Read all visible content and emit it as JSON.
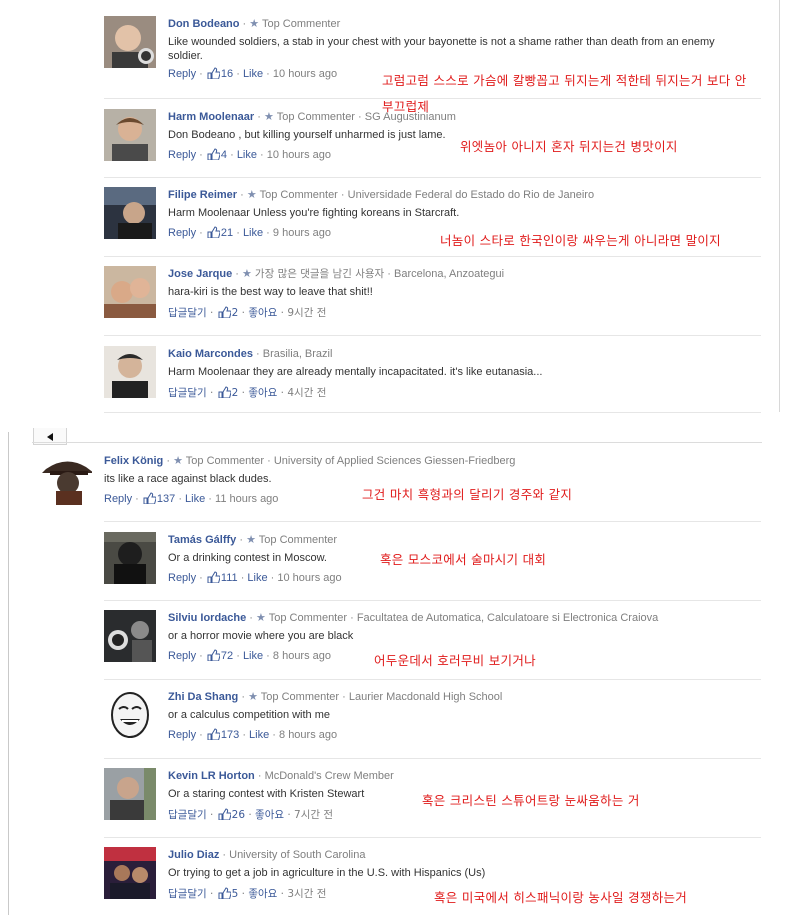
{
  "labels": {
    "top_commenter": "Top Commenter",
    "reply": "Reply",
    "like": "Like",
    "reply_ko": "답글달기",
    "like_ko": "좋아요",
    "top_commenter_ko": "가장 많은 댓글을 남긴 사용자"
  },
  "colors": {
    "link": "#3b5998",
    "annotation": "#e01b1b",
    "meta": "#7f7f7f"
  },
  "panel1": {
    "comments": [
      {
        "name": "Don Bodeano",
        "badge": "Top Commenter",
        "affiliation": "",
        "text": "Like wounded soldiers, a stab in your chest with your bayonette is not a shame rather than death from an enemy soldier.",
        "reply": "Reply",
        "likes": "16",
        "like": "Like",
        "time": "10 hours ago",
        "annotation": "고럼고럼 스스로 가슴에 칼빵꼽고 뒤지는게 적한테 뒤지는거 보다 안 부끄럽제"
      },
      {
        "name": "Harm Moolenaar",
        "badge": "Top Commenter",
        "affiliation": "SG Augustinianum",
        "text": "Don Bodeano , but killing yourself unharmed is just lame.",
        "reply": "Reply",
        "likes": "4",
        "like": "Like",
        "time": "10 hours ago",
        "annotation": "위엣놈아 아니지 혼자 뒤지는건 병맛이지"
      },
      {
        "name": "Filipe Reimer",
        "badge": "Top Commenter",
        "affiliation": "Universidade Federal do Estado do Rio de Janeiro",
        "text": "Harm Moolenaar Unless you're fighting koreans in Starcraft.",
        "reply": "Reply",
        "likes": "21",
        "like": "Like",
        "time": "9 hours ago",
        "annotation": "너놈이 스타로 한국인이랑 싸우는게 아니라면 말이지"
      },
      {
        "name": "Jose Jarque",
        "badge": "가장 많은 댓글을 남긴 사용자",
        "affiliation": "Barcelona, Anzoategui",
        "text": "hara-kiri is the best way to leave that shit!!",
        "reply": "답글달기",
        "likes": "2",
        "like": "좋아요",
        "time": "9시간 전",
        "annotation": ""
      },
      {
        "name": "Kaio Marcondes",
        "badge": "",
        "affiliation": "Brasilia, Brazil",
        "text": "Harm Moolenaar they are already mentally incapacitated. it's like eutanasia...",
        "reply": "답글달기",
        "likes": "2",
        "like": "좋아요",
        "time": "4시간 전",
        "annotation": ""
      }
    ]
  },
  "panel2": {
    "main": {
      "name": "Felix König",
      "badge": "Top Commenter",
      "affiliation": "University of Applied Sciences Giessen-Friedberg",
      "text": "its like a race against black dudes.",
      "reply": "Reply",
      "likes": "137",
      "like": "Like",
      "time": "11 hours ago",
      "annotation": "그건 마치 흑형과의 달리기 경주와 같지"
    },
    "replies": [
      {
        "name": "Tamás Gálffy",
        "badge": "Top Commenter",
        "affiliation": "",
        "text": "Or a drinking contest in Moscow.",
        "reply": "Reply",
        "likes": "111",
        "like": "Like",
        "time": "10 hours ago",
        "annotation": "혹은 모스코에서 술마시기 대회"
      },
      {
        "name": "Silviu Iordache",
        "badge": "Top Commenter",
        "affiliation": "Facultatea de Automatica, Calculatoare si Electronica Craiova",
        "text": "or a horror movie where you are black",
        "reply": "Reply",
        "likes": "72",
        "like": "Like",
        "time": "8 hours ago",
        "annotation": "어두운데서 호러무비 보기거나"
      },
      {
        "name": "Zhi Da Shang",
        "badge": "Top Commenter",
        "affiliation": "Laurier Macdonald High School",
        "text": "or a calculus competition with me",
        "reply": "Reply",
        "likes": "173",
        "like": "Like",
        "time": "8 hours ago",
        "annotation": ""
      },
      {
        "name": "Kevin LR Horton",
        "badge": "",
        "affiliation": "McDonald's Crew Member",
        "text": "Or a staring contest with Kristen Stewart",
        "reply": "답글달기",
        "likes": "26",
        "like": "좋아요",
        "time": "7시간 전",
        "annotation": "혹은 크리스틴 스튜어트랑 눈싸움하는 거"
      },
      {
        "name": "Julio Diaz",
        "badge": "",
        "affiliation": "University of South Carolina",
        "text": "Or trying to get a job in agriculture in the U.S. with Hispanics (Us)",
        "reply": "답글달기",
        "likes": "5",
        "like": "좋아요",
        "time": "3시간 전",
        "annotation": "혹은 미국에서 히스패닉이랑 농사일 경쟁하는거"
      }
    ]
  }
}
